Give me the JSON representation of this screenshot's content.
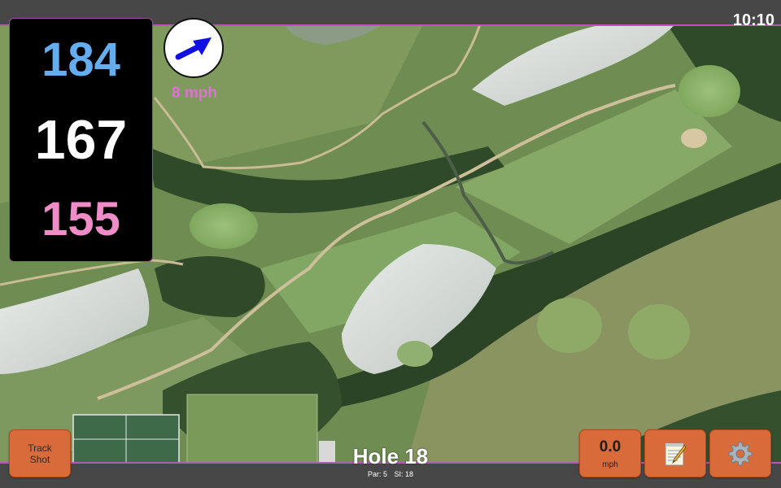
{
  "status": {
    "time": "10:10"
  },
  "distances": {
    "back": "184",
    "middle": "167",
    "front": "155",
    "colors": {
      "back": "#64aef0",
      "middle": "#ffffff",
      "front": "#f08cc8"
    }
  },
  "wind": {
    "speed_label": "8 mph",
    "arrow_color": "#1010e0",
    "label_color": "#e070d8",
    "direction_icon": "arrow-up-right"
  },
  "hole": {
    "title": "Hole 18",
    "par_label": "Par: 5",
    "si_label": "SI: 18"
  },
  "buttons": {
    "track_shot_line1": "Track",
    "track_shot_line2": "Shot",
    "speed_value": "0.0",
    "speed_unit": "mph",
    "notes_icon": "notepad-icon",
    "settings_icon": "gear-icon",
    "button_color": "#d96a39"
  },
  "map": {
    "type": "satellite-aerial",
    "feature_names": [
      "fairway",
      "green",
      "pond",
      "cart-path",
      "tree-line",
      "bunker",
      "tennis-court"
    ]
  }
}
